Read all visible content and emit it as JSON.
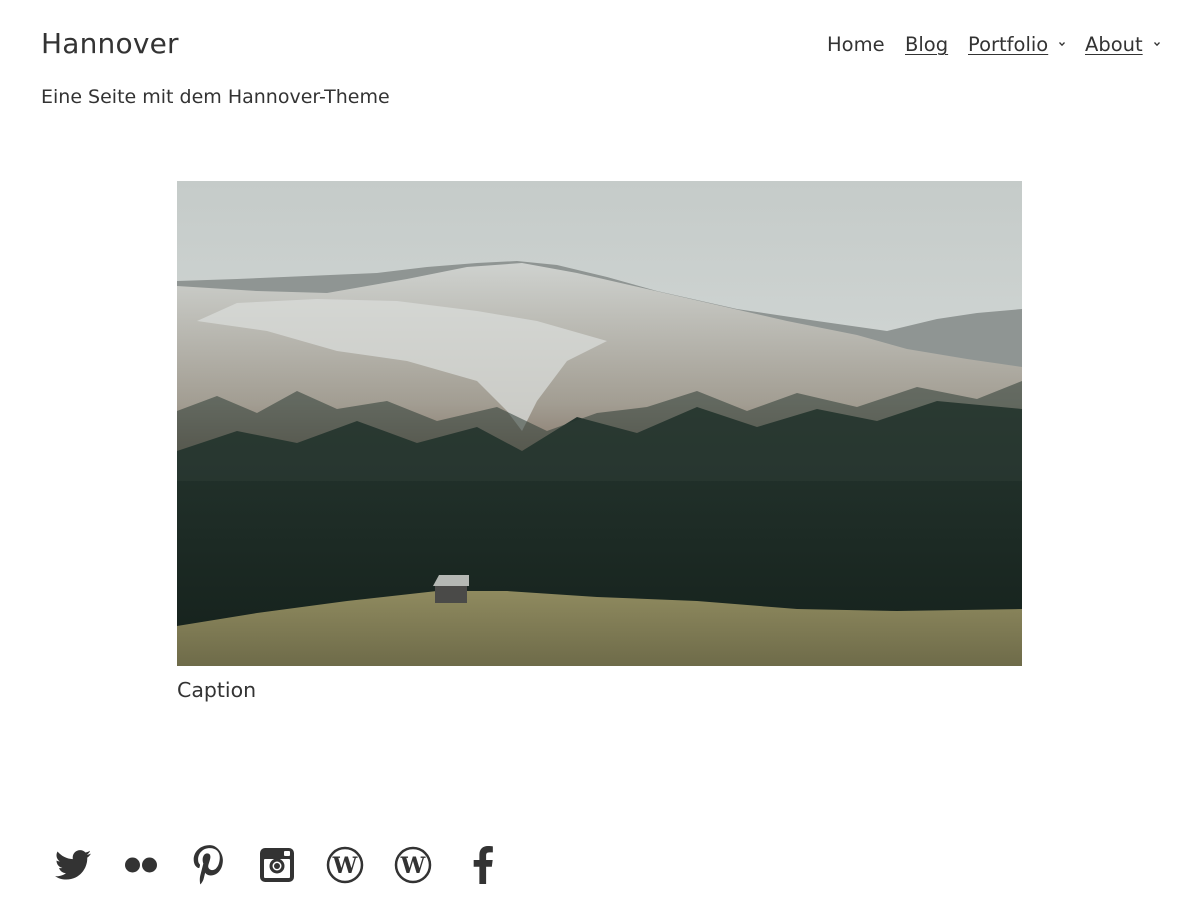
{
  "site": {
    "title": "Hannover",
    "description": "Eine Seite mit dem Hannover-Theme"
  },
  "nav": {
    "items": [
      {
        "label": "Home",
        "underlined": false,
        "has_submenu": false
      },
      {
        "label": "Blog",
        "underlined": true,
        "has_submenu": false
      },
      {
        "label": "Portfolio",
        "underlined": true,
        "has_submenu": true
      },
      {
        "label": "About",
        "underlined": true,
        "has_submenu": true
      }
    ]
  },
  "content": {
    "image_icon": "mountain-landscape-image",
    "caption": "Caption"
  },
  "social": {
    "icons": [
      "twitter-icon",
      "flickr-icon",
      "pinterest-icon",
      "instagram-icon",
      "wordpress-icon",
      "wordpress-icon",
      "facebook-icon"
    ]
  },
  "colors": {
    "text": "#333333",
    "background": "#ffffff"
  }
}
